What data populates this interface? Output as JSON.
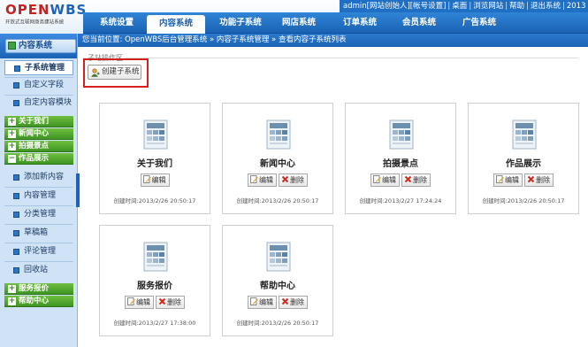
{
  "logo": {
    "name_a": "OPEN",
    "name_b": "WBS",
    "subtitle": "开放式互联网商务建站系统"
  },
  "userbar": [
    "admin[网站创始人]",
    "[帐号设置]",
    "桌面",
    "浏览网站",
    "帮助",
    "退出系统",
    "2013"
  ],
  "nav": [
    {
      "label": "系统设置",
      "active": false
    },
    {
      "label": "内容系统",
      "active": true
    },
    {
      "label": "功能子系统",
      "active": false
    },
    {
      "label": "网店系统",
      "active": false
    },
    {
      "label": "订单系统",
      "active": false
    },
    {
      "label": "会员系统",
      "active": false
    },
    {
      "label": "广告系统",
      "active": false
    }
  ],
  "breadcrumb": "您当前位置: OpenWBS后台管理系统 » 内容子系统管理 » 查看内容子系统列表",
  "sidebar": {
    "title": "内容系统",
    "items_top": [
      "子系统管理",
      "自定义字段",
      "自定内容模块"
    ],
    "categories_mid": [
      "关于我们",
      "新闻中心",
      "拍摄景点",
      "作品展示"
    ],
    "items_mid": [
      "添加新内容",
      "内容管理",
      "分类管理",
      "草稿箱",
      "评论管理",
      "回收站"
    ],
    "categories_bottom": [
      "服务报价",
      "帮助中心"
    ]
  },
  "toolbox": {
    "legend": "子站操作区",
    "create_label": "创建子系统"
  },
  "card_actions": {
    "edit": "编辑",
    "delete": "删除"
  },
  "cards": [
    {
      "title": "关于我们",
      "time": "创建时间:2013/2/26 20:50:17"
    },
    {
      "title": "新闻中心",
      "time": "创建时间:2013/2/26 20:50:17"
    },
    {
      "title": "拍摄景点",
      "time": "创建时间:2013/2/27 17:24:24"
    },
    {
      "title": "作品展示",
      "time": "创建时间:2013/2/26 20:50:17"
    },
    {
      "title": "服务报价",
      "time": "创建时间:2013/2/27 17:38:00"
    },
    {
      "title": "帮助中心",
      "time": "创建时间:2013/2/26 20:50:17"
    }
  ],
  "colors": {
    "primary": "#1d63b6",
    "accent_red": "#d62020",
    "category_green": "#3f9423"
  }
}
